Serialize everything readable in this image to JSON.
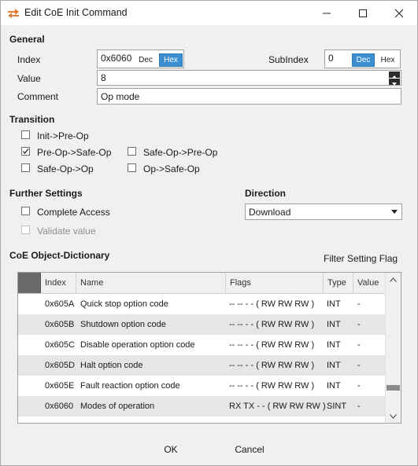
{
  "window": {
    "title": "Edit CoE Init Command"
  },
  "general": {
    "heading": "General",
    "index_label": "Index",
    "index_value": "0x6060",
    "subindex_label": "SubIndex",
    "subindex_value": "0",
    "dec_label": "Dec",
    "hex_label": "Hex",
    "value_label": "Value",
    "value_value": "8",
    "comment_label": "Comment",
    "comment_value": "Op mode"
  },
  "transition": {
    "heading": "Transition",
    "items": [
      {
        "label": "Init->Pre-Op",
        "checked": false
      },
      {
        "label": "Pre-Op->Safe-Op",
        "checked": true
      },
      {
        "label": "Safe-Op->Pre-Op",
        "checked": false
      },
      {
        "label": "Safe-Op->Op",
        "checked": false
      },
      {
        "label": "Op->Safe-Op",
        "checked": false
      }
    ]
  },
  "further": {
    "heading": "Further Settings",
    "complete_access": "Complete Access",
    "validate_value": "Validate value"
  },
  "direction": {
    "heading": "Direction",
    "selected": "Download"
  },
  "dictionary": {
    "heading": "CoE Object-Dictionary",
    "filter_label": "Filter Setting Flag",
    "columns": [
      "Index",
      "Name",
      "Flags",
      "Type",
      "Value"
    ],
    "rows": [
      {
        "index": "0x605A",
        "name": "Quick stop option code",
        "flags": "-- -- - - ( RW RW RW )",
        "type": "INT",
        "value": "-"
      },
      {
        "index": "0x605B",
        "name": "Shutdown option code",
        "flags": "-- -- - - ( RW RW RW )",
        "type": "INT",
        "value": "-"
      },
      {
        "index": "0x605C",
        "name": "Disable operation option code",
        "flags": "-- -- - - ( RW RW RW )",
        "type": "INT",
        "value": "-"
      },
      {
        "index": "0x605D",
        "name": "Halt option code",
        "flags": "-- -- - - ( RW RW RW )",
        "type": "INT",
        "value": "-"
      },
      {
        "index": "0x605E",
        "name": "Fault reaction option code",
        "flags": "-- -- - - ( RW RW RW )",
        "type": "INT",
        "value": "-"
      },
      {
        "index": "0x6060",
        "name": "Modes of operation",
        "flags": "RX TX - - ( RW RW RW )",
        "type": "SINT",
        "value": "-"
      }
    ]
  },
  "buttons": {
    "ok": "OK",
    "cancel": "Cancel"
  },
  "colors": {
    "accent": "#3b8fd1",
    "icon_orange": "#e8782a"
  }
}
